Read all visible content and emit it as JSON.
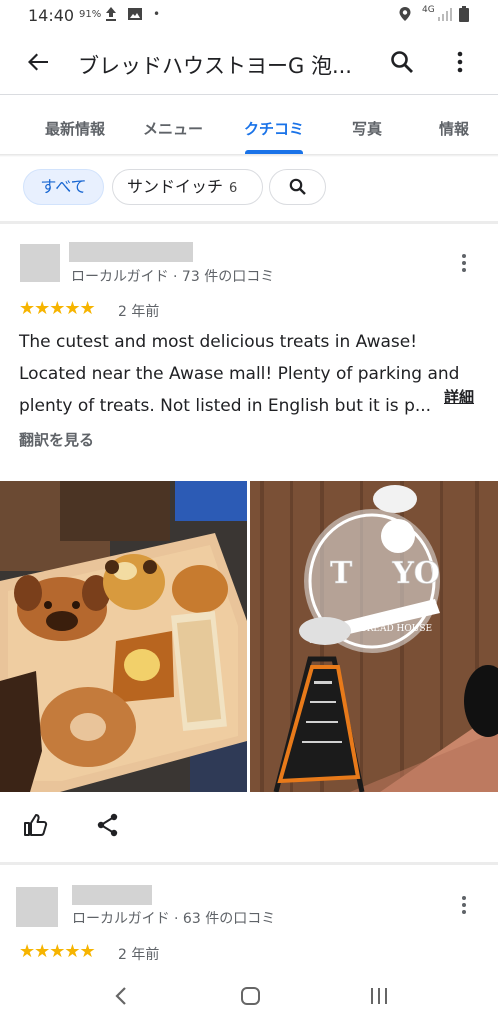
{
  "status_bar": {
    "time": "14:40",
    "battery_pct": "91",
    "network": "4G",
    "dot": "•"
  },
  "app_bar": {
    "title": "ブレッドハウストヨーG 泡..."
  },
  "tabs": [
    {
      "label": "最新情報",
      "active": false
    },
    {
      "label": "メニュー",
      "active": false
    },
    {
      "label": "クチコミ",
      "active": true
    },
    {
      "label": "写真",
      "active": false
    },
    {
      "label": "情報",
      "active": false
    }
  ],
  "filters": {
    "all_label": "すべて",
    "sandwich_label": "サンドイッチ",
    "sandwich_count": "6"
  },
  "reviews": [
    {
      "meta": "ローカルガイド · 73 件の口コミ",
      "rating": 5,
      "stars": "★★★★★",
      "date": "2 年前",
      "text_line1": "The cutest and most delicious treats in Awase!",
      "text_line2": "Located near the Awase mall! Plenty of parking and",
      "text_line3": "plenty of treats. Not listed in English but it is p...",
      "more_label": "詳細",
      "translate_label": "翻訳を見る",
      "photo_sign_text": "TOYO",
      "photo_sign_subtext": "BREAD HOUSE"
    },
    {
      "meta": "ローカルガイド · 63 件の口コミ",
      "rating": 5,
      "stars": "★★★★★",
      "date": "2 年前"
    }
  ],
  "colors": {
    "accent": "#1a73e8",
    "star": "#f6b400",
    "chip_selected_bg": "#e8f0fe"
  }
}
